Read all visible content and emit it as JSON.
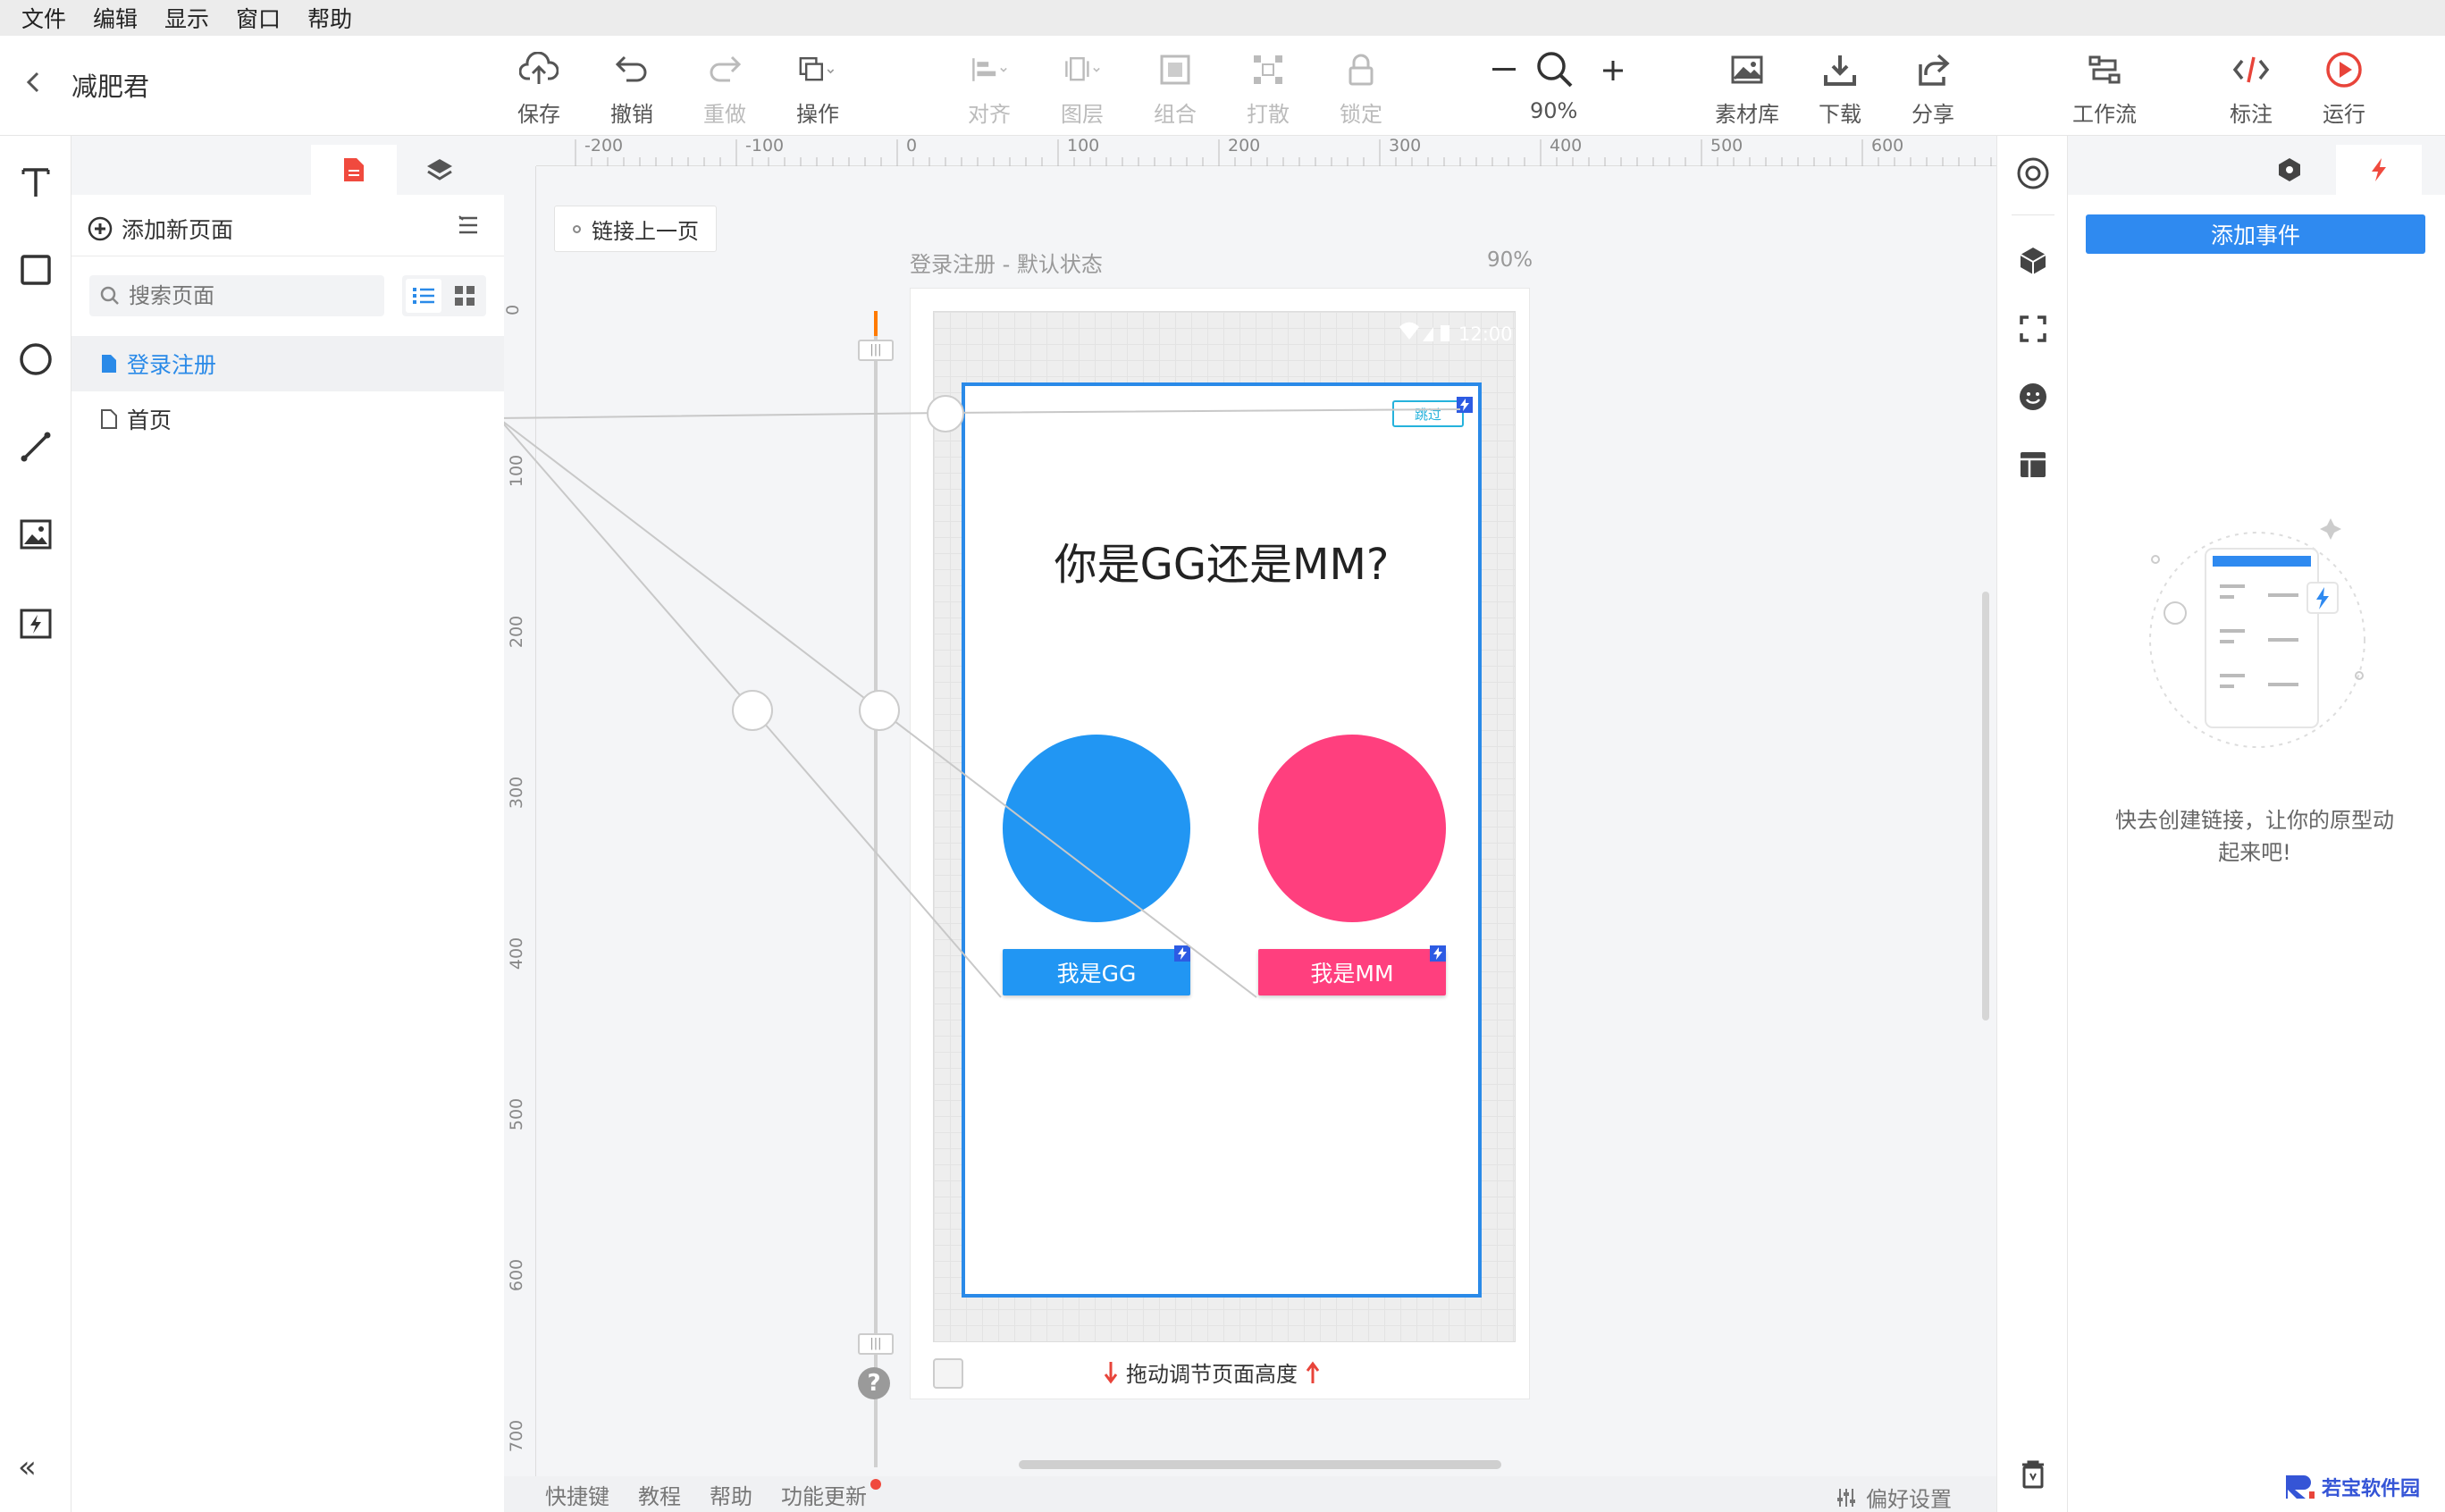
{
  "menu": [
    "文件",
    "编辑",
    "显示",
    "窗口",
    "帮助"
  ],
  "project": {
    "title": "减肥君"
  },
  "toolbar": {
    "save": "保存",
    "undo": "撤销",
    "redo": "重做",
    "operate": "操作",
    "align": "对齐",
    "layer": "图层",
    "group": "组合",
    "ungroup": "打散",
    "lock": "锁定",
    "zoom": "90%",
    "assets": "素材库",
    "download": "下载",
    "share": "分享",
    "workflow": "工作流",
    "annotate": "标注",
    "run": "运行"
  },
  "pages_panel": {
    "add_page": "添加新页面",
    "search_placeholder": "搜索页面",
    "pages": [
      {
        "label": "登录注册",
        "active": true
      },
      {
        "label": "首页",
        "active": false
      }
    ]
  },
  "canvas": {
    "ruler_x": [
      "-200",
      "-100",
      "0",
      "100",
      "200",
      "300",
      "400",
      "500",
      "600"
    ],
    "ruler_y": [
      "0",
      "100",
      "200",
      "300",
      "400",
      "500",
      "600",
      "700"
    ],
    "link_prev": "链接上一页",
    "state_name": "登录注册 - 默认状态",
    "zoom_label": "90%",
    "status_time": "12:00",
    "screen": {
      "skip_label": "跳过",
      "heading": "你是GG还是MM?",
      "circle_left_color": "#2196f3",
      "circle_right_color": "#ff3f7e",
      "button_gg": "我是GG",
      "button_mm": "我是MM"
    },
    "drag_note": "拖动调节页面高度"
  },
  "bottombar": {
    "shortcuts": "快捷键",
    "tutorial": "教程",
    "help": "帮助",
    "updates": "功能更新",
    "prefs": "偏好设置"
  },
  "events_panel": {
    "add_event": "添加事件",
    "empty_text": "快去创建链接，让你的原型动起来吧!"
  },
  "brand": {
    "name": "若宝软件园"
  }
}
